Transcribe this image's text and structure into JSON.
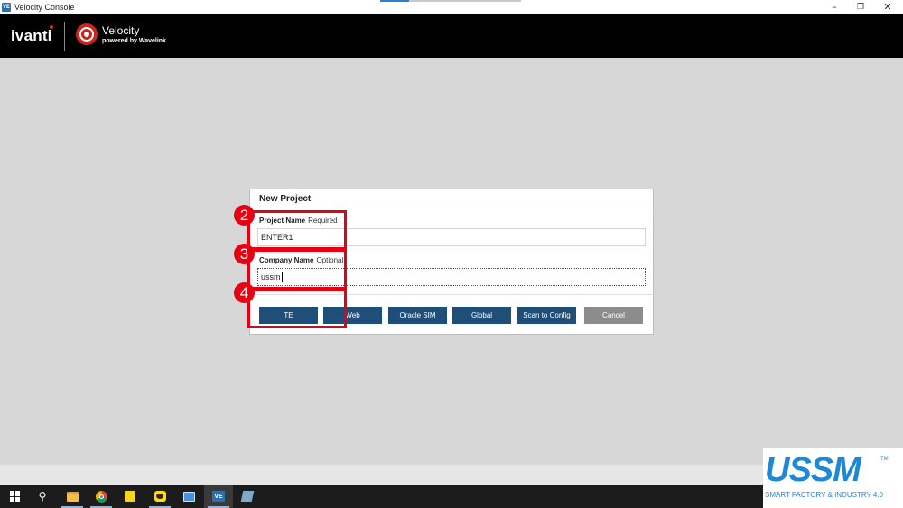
{
  "window": {
    "icon_text": "VE",
    "title": "Velocity Console",
    "minimize_icon": "minimize-icon",
    "restore_icon": "restore-icon",
    "close_icon": "close-icon"
  },
  "header": {
    "brand": "ivanti",
    "product_name": "Velocity",
    "product_sub": "powered by Wavelink"
  },
  "dialog": {
    "title": "New Project",
    "project_name_label": "Project Name",
    "project_name_hint": "Required",
    "project_name_value": "ENTER1",
    "company_name_label": "Company Name",
    "company_name_hint": "Optional",
    "company_name_value": "ussm",
    "buttons": {
      "te": "TE",
      "web": "Web",
      "oracle_sim": "Oracle SIM",
      "global": "Global",
      "scan_to_config": "Scan to Config",
      "cancel": "Cancel"
    }
  },
  "annotations": [
    "2",
    "3",
    "4"
  ],
  "watermark": {
    "logo": "USSM",
    "tm": "TM",
    "tagline": "SMART FACTORY & INDUSTRY 4.0"
  },
  "taskbar": {
    "items": [
      "windows-start-icon",
      "search-icon",
      "file-explorer-icon",
      "chrome-icon",
      "sticky-notes-icon",
      "kakaotalk-icon",
      "mail-icon",
      "velocity-icon",
      "app-icon"
    ],
    "velocity_label": "VE"
  },
  "colors": {
    "accent_blue": "#1f4e79",
    "cancel_gray": "#8c8c8c",
    "annotation_red": "#e60012",
    "header_black": "#000000",
    "ussm_blue": "#1e88d6"
  }
}
